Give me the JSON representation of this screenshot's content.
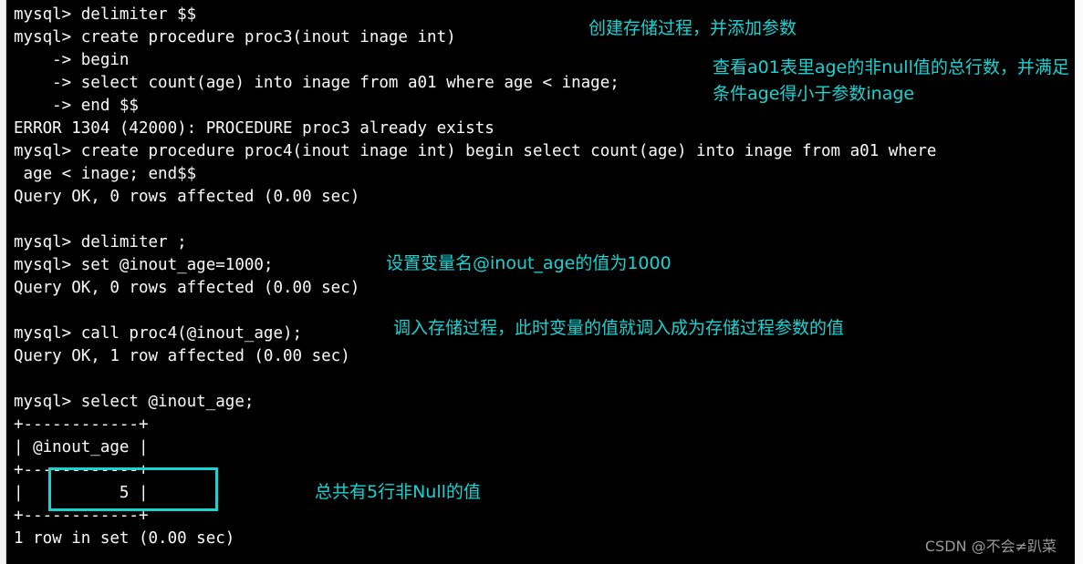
{
  "window": {
    "type": "terminal-console",
    "background_color": "#000000",
    "text_color": "#f5f5f5",
    "annotation_color": "#19d3d3",
    "watermark_color": "#9a9a9a"
  },
  "console": {
    "lines": [
      "mysql> delimiter $$",
      "mysql> create procedure proc3(inout inage int)",
      "    -> begin",
      "    -> select count(age) into inage from a01 where age < inage;",
      "    -> end $$",
      "ERROR 1304 (42000): PROCEDURE proc3 already exists",
      "mysql> create procedure proc4(inout inage int) begin select count(age) into inage from a01 where",
      " age < inage; end$$",
      "Query OK, 0 rows affected (0.00 sec)",
      "",
      "mysql> delimiter ;",
      "mysql> set @inout_age=1000;",
      "Query OK, 0 rows affected (0.00 sec)",
      "",
      "mysql> call proc4(@inout_age);",
      "Query OK, 1 row affected (0.00 sec)",
      "",
      "mysql> select @inout_age;",
      "+------------+",
      "| @inout_age |",
      "+------------+",
      "|          5 |",
      "+------------+",
      "1 row in set (0.00 sec)"
    ],
    "text": "mysql> delimiter $$\nmysql> create procedure proc3(inout inage int)\n    -> begin\n    -> select count(age) into inage from a01 where age < inage;\n    -> end $$\nERROR 1304 (42000): PROCEDURE proc3 already exists\nmysql> create procedure proc4(inout inage int) begin select count(age) into inage from a01 where\n age < inage; end$$\nQuery OK, 0 rows affected (0.00 sec)\n\nmysql> delimiter ;\nmysql> set @inout_age=1000;\nQuery OK, 0 rows affected (0.00 sec)\n\nmysql> call proc4(@inout_age);\nQuery OK, 1 row affected (0.00 sec)\n\nmysql> select @inout_age;\n+------------+\n| @inout_age |\n+------------+\n|          5 |\n+------------+\n1 row in set (0.00 sec)"
  },
  "result_table": {
    "column_header": "@inout_age",
    "values": [
      "5"
    ],
    "row_count_text": "1 row in set (0.00 sec)"
  },
  "annotations": {
    "create_procedure": "创建存储过程，并添加参数",
    "count_explanation": "查看a01表里age的非null值的总行数，并满足条件age得小于参数inage",
    "set_variable": "设置变量名@inout_age的值为1000",
    "call_procedure": "调入存储过程，此时变量的值就调入成为存储过程参数的值",
    "result_note": "总共有5行非Null的值"
  },
  "watermark": {
    "text": "CSDN @不会≠趴菜"
  }
}
